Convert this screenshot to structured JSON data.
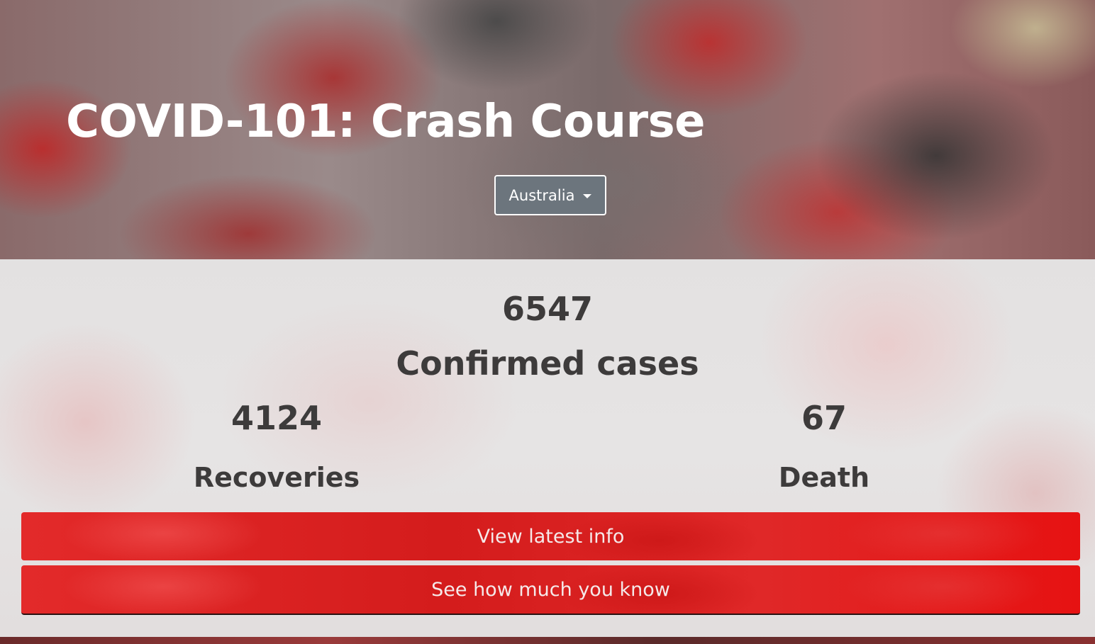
{
  "header": {
    "title": "COVID-101: Crash Course",
    "country_selector": {
      "selected": "Australia",
      "icon": "caret-down-icon"
    }
  },
  "stats": {
    "confirmed": {
      "value": "6547",
      "label": "Confirmed cases"
    },
    "recoveries": {
      "value": "4124",
      "label": "Recoveries"
    },
    "death": {
      "value": "67",
      "label": "Death"
    }
  },
  "actions": {
    "view_latest_info": "View latest info",
    "quiz": "See how much you know"
  },
  "colors": {
    "button_red": "#e02828",
    "dropdown_grey": "#6c757d",
    "stat_text": "#3d3b3b",
    "title_text": "#ffffff"
  }
}
